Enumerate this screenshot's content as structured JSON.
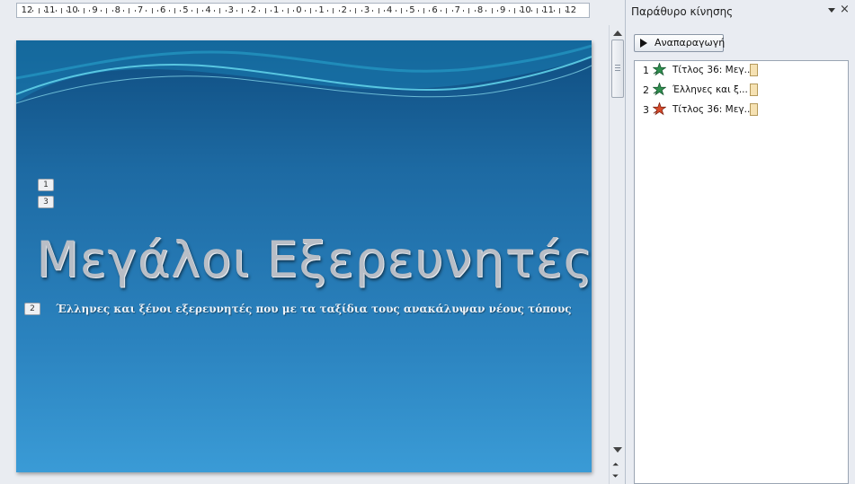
{
  "ruler": {
    "labels": [
      "12",
      "11",
      "10",
      "9",
      "8",
      "7",
      "6",
      "5",
      "4",
      "3",
      "2",
      "1",
      "0",
      "1",
      "2",
      "3",
      "4",
      "5",
      "6",
      "7",
      "8",
      "9",
      "10",
      "11",
      "12"
    ]
  },
  "slide": {
    "title": "Μεγάλοι Εξερευνητές",
    "subtitle": "Έλληνες και ξένοι εξερευνητές που με τα ταξίδια τους ανακάλυψαν  νέους τόπους",
    "tags": [
      "1",
      "3",
      "2"
    ]
  },
  "pane": {
    "title": "Παράθυρο κίνησης",
    "close_icon": "×",
    "play_label": "Αναπαραγωγή",
    "items": [
      {
        "num": "1",
        "label": "Τίτλος 36: Μεγ...",
        "effect": "entrance",
        "color": "#2f8f4e"
      },
      {
        "num": "2",
        "label": "Έλληνες και ξ...",
        "effect": "entrance",
        "color": "#2f8f4e"
      },
      {
        "num": "3",
        "label": "Τίτλος 36: Μεγ...",
        "effect": "emphasis",
        "color": "#d64a2a"
      }
    ]
  },
  "scroll": {
    "prev_slide_icon": "⏶",
    "next_slide_icon": "⏷"
  }
}
